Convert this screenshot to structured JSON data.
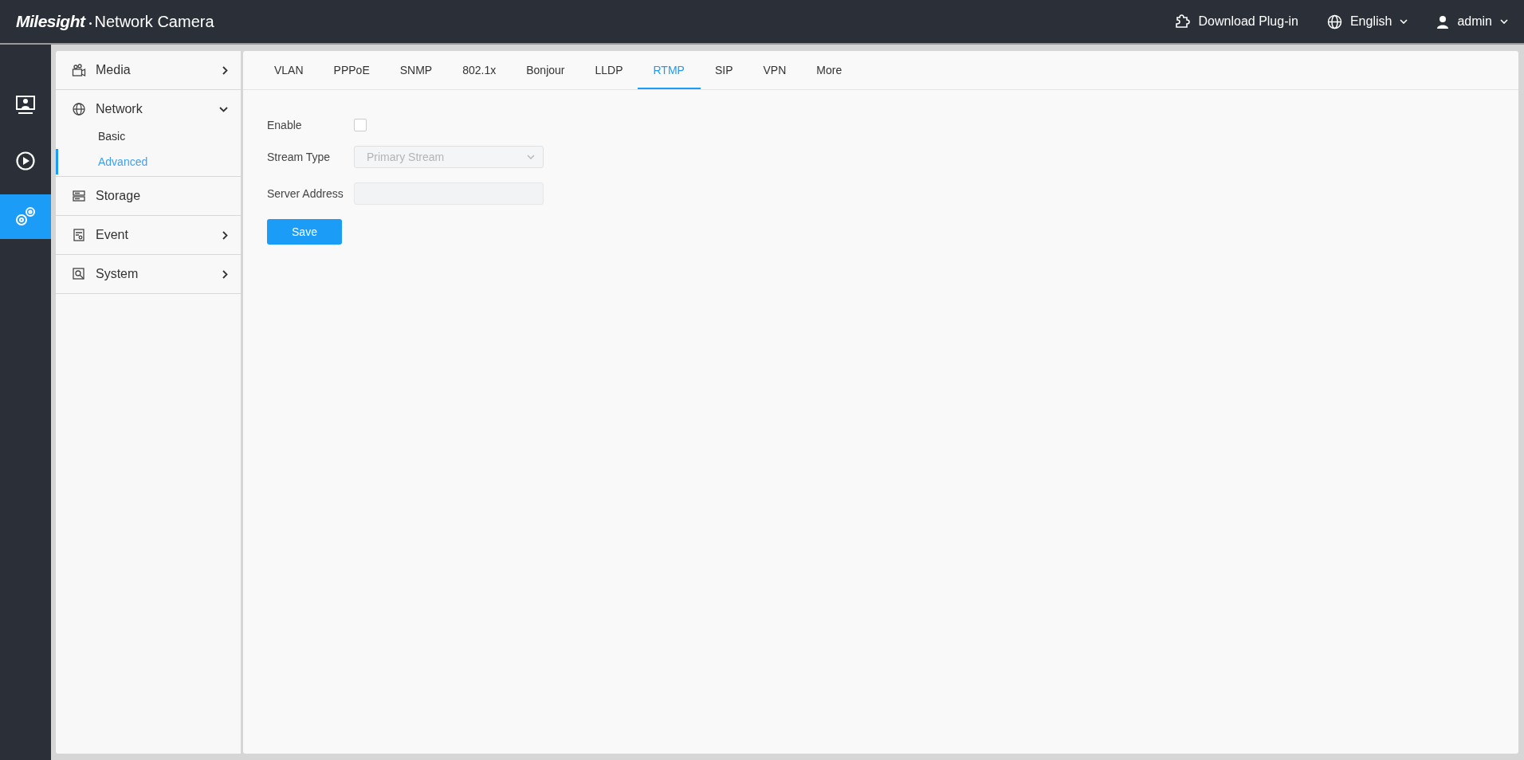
{
  "header": {
    "logo": "Milesight",
    "title": "Network Camera",
    "actions": [
      {
        "kind": "plugin",
        "label": "Download Plug-in",
        "dropdown": false
      },
      {
        "kind": "language",
        "label": "English",
        "dropdown": true
      },
      {
        "kind": "user",
        "label": "admin",
        "dropdown": true
      }
    ]
  },
  "rail": [
    {
      "kind": "live",
      "selected": false
    },
    {
      "kind": "playback",
      "selected": false
    },
    {
      "kind": "settings",
      "selected": true
    }
  ],
  "sidebar": {
    "items": [
      {
        "kind": "media",
        "label": "Media",
        "expanded": false
      },
      {
        "kind": "network",
        "label": "Network",
        "expanded": true,
        "children": [
          {
            "label": "Basic",
            "selected": false
          },
          {
            "label": "Advanced",
            "selected": true
          }
        ]
      },
      {
        "kind": "storage",
        "label": "Storage"
      },
      {
        "kind": "event",
        "label": "Event",
        "expanded": false
      },
      {
        "kind": "system",
        "label": "System",
        "expanded": false
      }
    ]
  },
  "tabs": [
    {
      "label": "VLAN",
      "selected": false
    },
    {
      "label": "PPPoE",
      "selected": false
    },
    {
      "label": "SNMP",
      "selected": false
    },
    {
      "label": "802.1x",
      "selected": false
    },
    {
      "label": "Bonjour",
      "selected": false
    },
    {
      "label": "LLDP",
      "selected": false
    },
    {
      "label": "RTMP",
      "selected": true
    },
    {
      "label": "SIP",
      "selected": false
    },
    {
      "label": "VPN",
      "selected": false
    },
    {
      "label": "More",
      "selected": false
    }
  ],
  "form": {
    "fields": [
      {
        "kind": "checkbox",
        "label": "Enable",
        "checked": false
      },
      {
        "kind": "select",
        "label": "Stream Type",
        "value": "Primary Stream",
        "disabled": true
      },
      {
        "kind": "text",
        "label": "Server Address",
        "disabled": true
      }
    ],
    "save_button": "Save"
  }
}
